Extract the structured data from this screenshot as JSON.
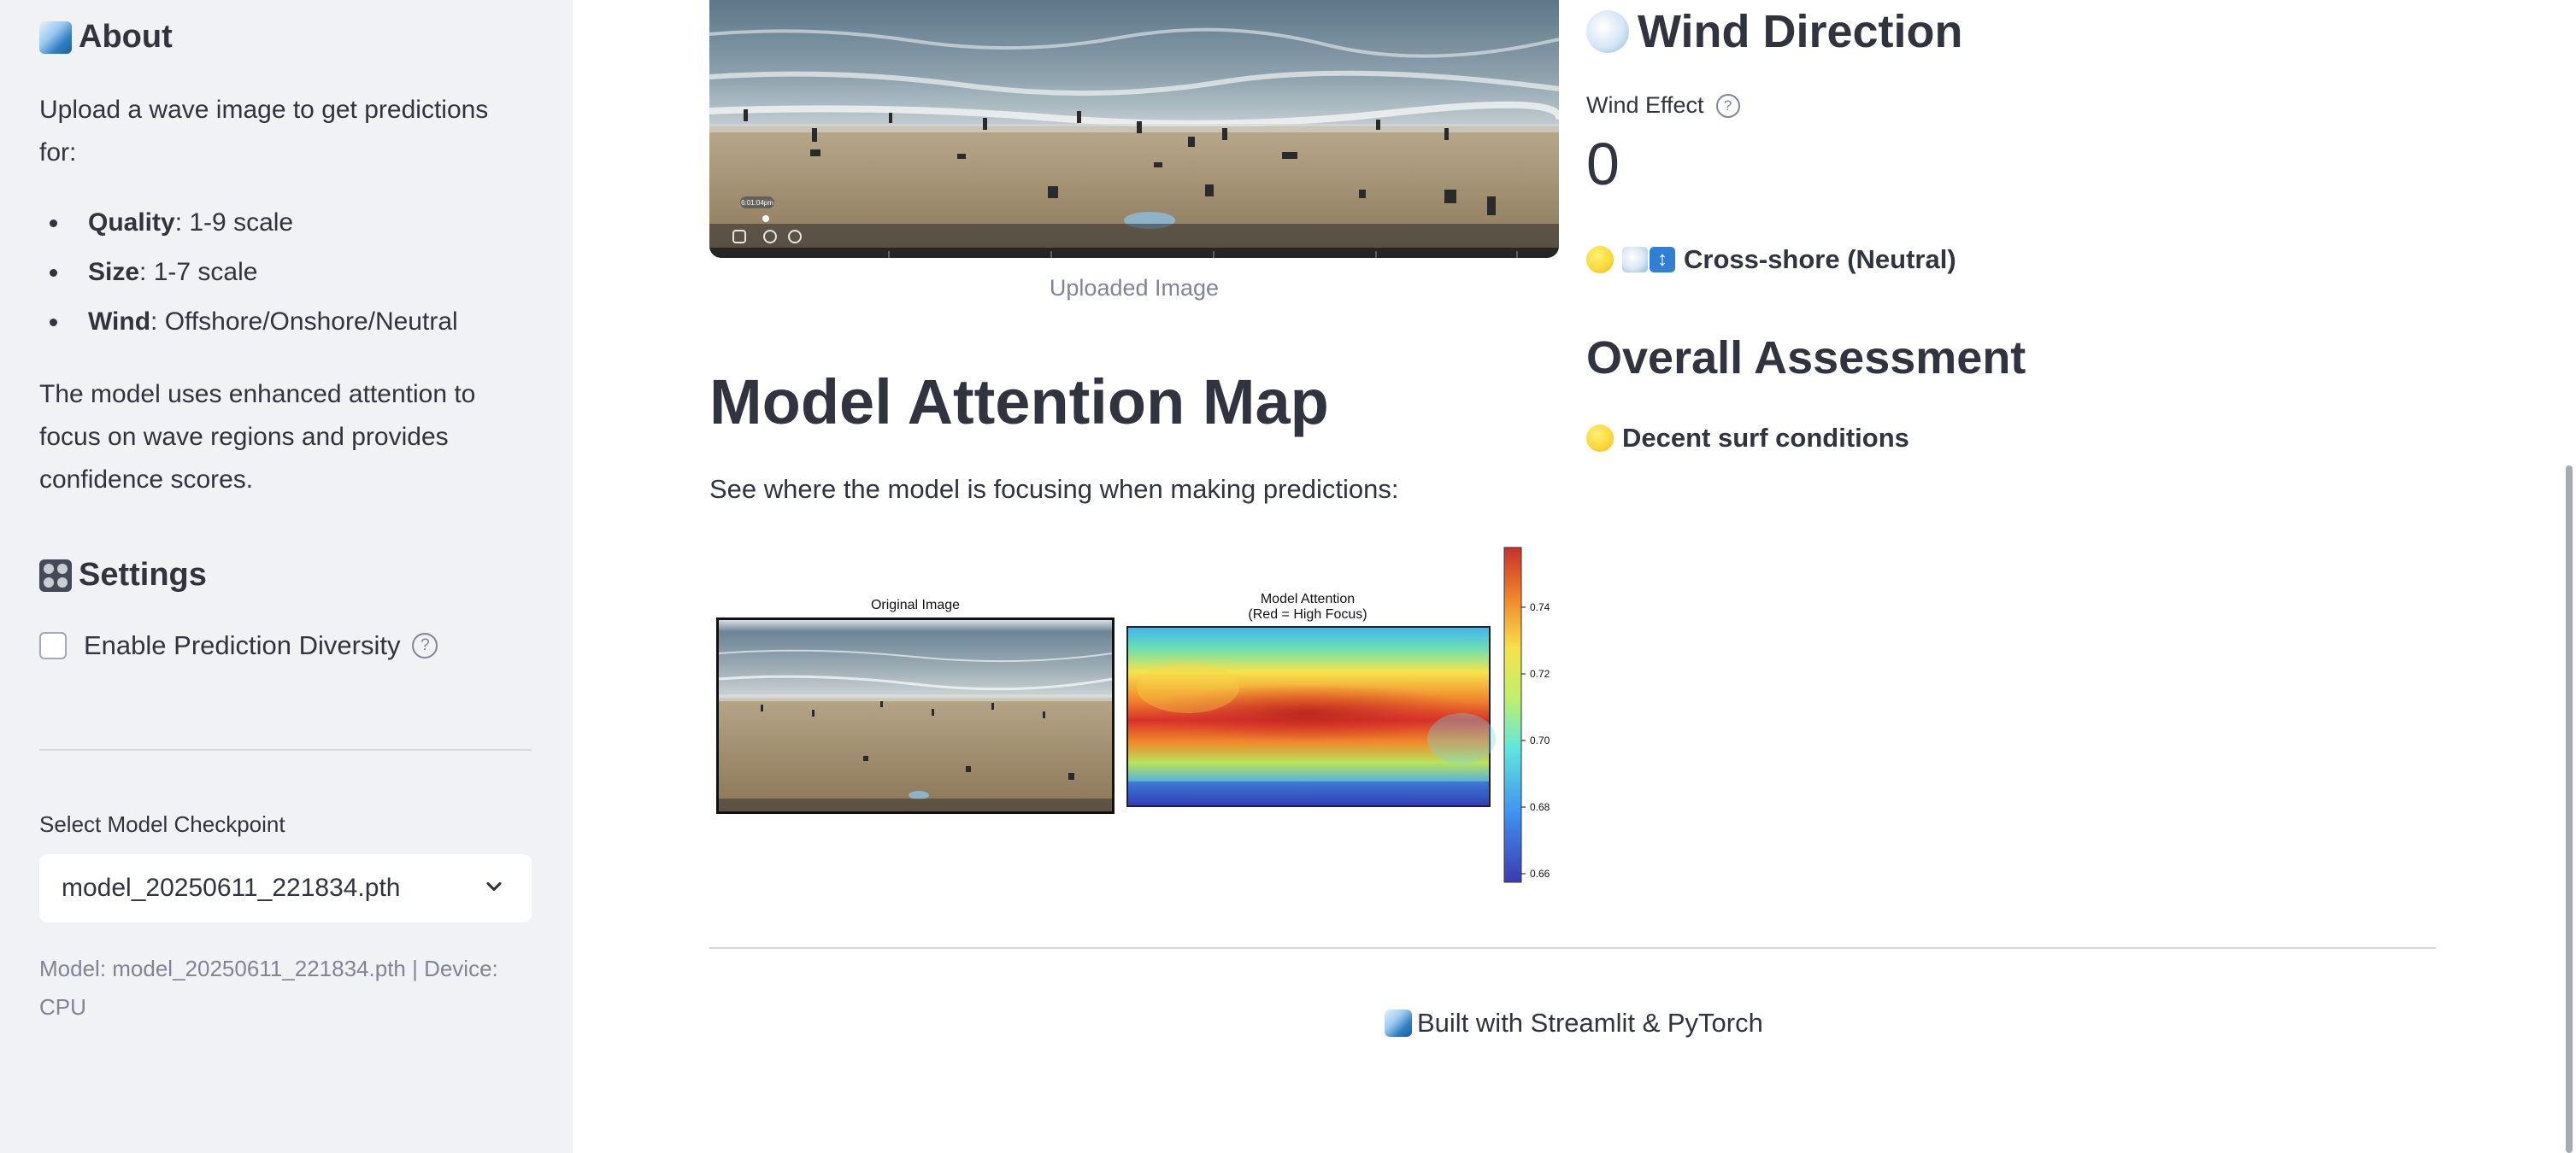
{
  "sidebar": {
    "about": {
      "icon": "wave-emoji",
      "title": "About",
      "intro": "Upload a wave image to get predictions for:",
      "bullets": [
        {
          "term": "Quality",
          "desc": ": 1-9 scale"
        },
        {
          "term": "Size",
          "desc": ": 1-7 scale"
        },
        {
          "term": "Wind",
          "desc": ": Offshore/Onshore/Neutral"
        }
      ],
      "description": "The model uses enhanced attention to focus on wave regions and provides confidence scores."
    },
    "settings": {
      "icon": "control-knobs-emoji",
      "title": "Settings",
      "diversity_label": "Enable Prediction Diversity",
      "diversity_checked": false,
      "help_glyph": "?"
    },
    "checkpoint": {
      "label": "Select Model Checkpoint",
      "selected": "model_20250611_221834.pth"
    },
    "model_info": "Model: model_20250611_221834.pth | Device: CPU"
  },
  "main": {
    "uploaded_caption": "Uploaded Image",
    "overlay_time": "6:01:04pm",
    "attention": {
      "title": "Model Attention Map",
      "description": "See where the model is focusing when making predictions:",
      "left_title": "Original Image",
      "right_title_1": "Model Attention",
      "right_title_2": "(Red = High Focus)",
      "colorbar_ticks": [
        "0.74",
        "0.72",
        "0.70",
        "0.68",
        "0.66"
      ]
    },
    "wind": {
      "icon": "dashing-away-emoji",
      "title": "Wind Direction",
      "metric_label": "Wind Effect",
      "metric_value": "0",
      "status_icon": "yellow-circle-emoji",
      "status": "Cross-shore (Neutral)"
    },
    "overall": {
      "title": "Overall Assessment",
      "status_icon": "yellow-circle-emoji",
      "status": "Decent surf conditions"
    },
    "footer": "Built with Streamlit & PyTorch"
  },
  "colors": {
    "sidebar_bg": "#f0f2f6",
    "text": "#31333f",
    "muted": "#808495",
    "divider": "#d5d8de"
  }
}
